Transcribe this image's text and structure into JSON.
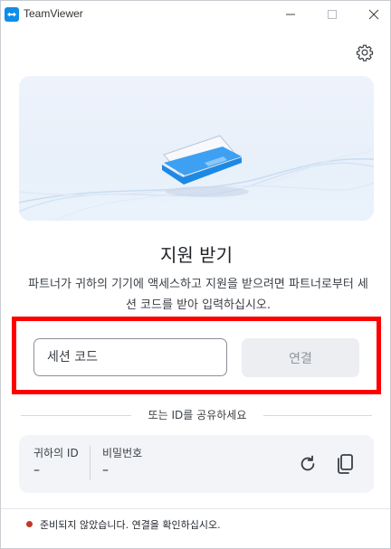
{
  "window": {
    "title": "TeamViewer"
  },
  "main": {
    "heading": "지원 받기",
    "description": "파트너가 귀하의 기기에 액세스하고 지원을 받으려면 파트너로부터 세션 코드를 받아 입력하십시오.",
    "session_input": {
      "placeholder": "세션 코드",
      "value": ""
    },
    "connect_label": "연결",
    "divider_text": "또는 ID를 공유하세요"
  },
  "id_card": {
    "id_label": "귀하의 ID",
    "id_value": "–",
    "password_label": "비밀번호",
    "password_value": "–"
  },
  "status": {
    "text": "준비되지 않았습니다. 연결을 확인하십시오.",
    "color": "#c0392b"
  },
  "colors": {
    "brand": "#0e8ee9",
    "highlight": "#ff0000"
  }
}
